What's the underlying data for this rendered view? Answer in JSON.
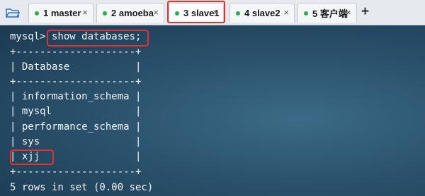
{
  "tabs": [
    {
      "label": "1 master",
      "close": "×"
    },
    {
      "label": "2 amoeba",
      "close": "×"
    },
    {
      "label": "3 slave1",
      "close": "×"
    },
    {
      "label": "4 slave2",
      "close": "×"
    },
    {
      "label": "5 客户端",
      "close": "×"
    }
  ],
  "new_tab_label": "+",
  "icons": {
    "open": "folder-icon",
    "status": "green-dot-icon"
  },
  "colors": {
    "terminal_bg": "#2b536e",
    "highlight": "#e0332b",
    "status_dot": "#1fb345"
  },
  "terminal": {
    "prompt_line": "mysql> show databases;",
    "border_top": "+--------------------+",
    "header": "| Database           |",
    "border_mid": "+--------------------+",
    "rows": [
      "| information_schema |",
      "| mysql              |",
      "| performance_schema |",
      "| sys                |",
      "| xjj                |"
    ],
    "border_bottom": "+--------------------+",
    "result": "5 rows in set (0.00 sec)"
  }
}
